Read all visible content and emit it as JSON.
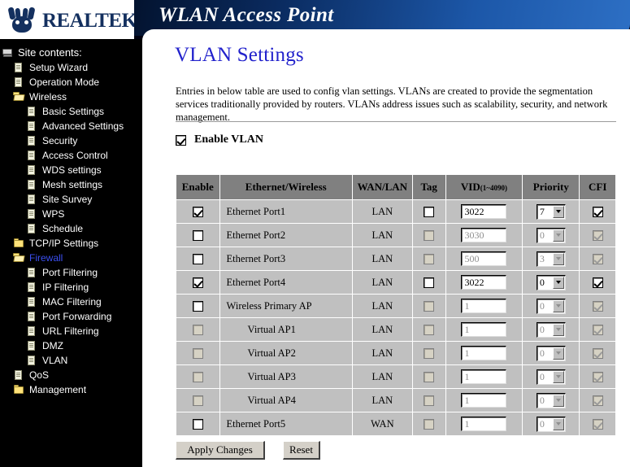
{
  "brand": {
    "logo_text": "REALTEK",
    "banner_title": "WLAN Access Point"
  },
  "sidebar": {
    "root_label": "Site contents:",
    "items": [
      {
        "label": "Setup Wizard",
        "level": 1,
        "icon": "page-icon",
        "active": false
      },
      {
        "label": "Operation Mode",
        "level": 1,
        "icon": "page-icon",
        "active": false
      },
      {
        "label": "Wireless",
        "level": 1,
        "icon": "folder-open-icon",
        "active": false
      },
      {
        "label": "Basic Settings",
        "level": 2,
        "icon": "page-icon",
        "active": false
      },
      {
        "label": "Advanced Settings",
        "level": 2,
        "icon": "page-icon",
        "active": false
      },
      {
        "label": "Security",
        "level": 2,
        "icon": "page-icon",
        "active": false
      },
      {
        "label": "Access Control",
        "level": 2,
        "icon": "page-icon",
        "active": false
      },
      {
        "label": "WDS settings",
        "level": 2,
        "icon": "page-icon",
        "active": false
      },
      {
        "label": "Mesh settings",
        "level": 2,
        "icon": "page-icon",
        "active": false
      },
      {
        "label": "Site Survey",
        "level": 2,
        "icon": "page-icon",
        "active": false
      },
      {
        "label": "WPS",
        "level": 2,
        "icon": "page-icon",
        "active": false
      },
      {
        "label": "Schedule",
        "level": 2,
        "icon": "page-icon",
        "active": false
      },
      {
        "label": "TCP/IP Settings",
        "level": 1,
        "icon": "folder-icon",
        "active": false
      },
      {
        "label": "Firewall",
        "level": 1,
        "icon": "folder-open-icon",
        "active": true
      },
      {
        "label": "Port Filtering",
        "level": 2,
        "icon": "page-icon",
        "active": false
      },
      {
        "label": "IP Filtering",
        "level": 2,
        "icon": "page-icon",
        "active": false
      },
      {
        "label": "MAC Filtering",
        "level": 2,
        "icon": "page-icon",
        "active": false
      },
      {
        "label": "Port Forwarding",
        "level": 2,
        "icon": "page-icon",
        "active": false
      },
      {
        "label": "URL Filtering",
        "level": 2,
        "icon": "page-icon",
        "active": false
      },
      {
        "label": "DMZ",
        "level": 2,
        "icon": "page-icon",
        "active": false
      },
      {
        "label": "VLAN",
        "level": 2,
        "icon": "page-icon",
        "active": false
      },
      {
        "label": "QoS",
        "level": 1,
        "icon": "page-icon",
        "active": false
      },
      {
        "label": "Management",
        "level": 1,
        "icon": "folder-icon",
        "active": false
      }
    ],
    "active_color": "#3b4ff0"
  },
  "main": {
    "title": "VLAN Settings",
    "title_color": "#2222cc",
    "description": "Entries in below table are used to config vlan settings. VLANs are created to provide the segmentation services traditionally provided by routers. VLANs address issues such as scalability, security, and network management.",
    "enable_vlan": {
      "label": "Enable VLAN",
      "checked": true
    },
    "table": {
      "columns": [
        "Enable",
        "Ethernet/Wireless",
        "WAN/LAN",
        "Tag",
        "VID",
        "Priority",
        "CFI"
      ],
      "vid_range_note": "(1~4090)",
      "rows": [
        {
          "interface": "Ethernet Port1",
          "indent": false,
          "enable": true,
          "enable_disabled": false,
          "wan_lan": "LAN",
          "tag": false,
          "tag_disabled": false,
          "vid": "3022",
          "vid_disabled": false,
          "priority": "7",
          "priority_disabled": false,
          "cfi": true,
          "cfi_disabled": false
        },
        {
          "interface": "Ethernet Port2",
          "indent": false,
          "enable": false,
          "enable_disabled": false,
          "wan_lan": "LAN",
          "tag": false,
          "tag_disabled": true,
          "vid": "3030",
          "vid_disabled": true,
          "priority": "0",
          "priority_disabled": true,
          "cfi": true,
          "cfi_disabled": true
        },
        {
          "interface": "Ethernet Port3",
          "indent": false,
          "enable": false,
          "enable_disabled": false,
          "wan_lan": "LAN",
          "tag": false,
          "tag_disabled": true,
          "vid": "500",
          "vid_disabled": true,
          "priority": "3",
          "priority_disabled": true,
          "cfi": true,
          "cfi_disabled": true
        },
        {
          "interface": "Ethernet Port4",
          "indent": false,
          "enable": true,
          "enable_disabled": false,
          "wan_lan": "LAN",
          "tag": false,
          "tag_disabled": false,
          "vid": "3022",
          "vid_disabled": false,
          "priority": "0",
          "priority_disabled": false,
          "cfi": true,
          "cfi_disabled": false
        },
        {
          "interface": "Wireless Primary AP",
          "indent": false,
          "enable": false,
          "enable_disabled": false,
          "wan_lan": "LAN",
          "tag": false,
          "tag_disabled": true,
          "vid": "1",
          "vid_disabled": true,
          "priority": "0",
          "priority_disabled": true,
          "cfi": true,
          "cfi_disabled": true
        },
        {
          "interface": "Virtual AP1",
          "indent": true,
          "enable": false,
          "enable_disabled": true,
          "wan_lan": "LAN",
          "tag": false,
          "tag_disabled": true,
          "vid": "1",
          "vid_disabled": true,
          "priority": "0",
          "priority_disabled": true,
          "cfi": true,
          "cfi_disabled": true
        },
        {
          "interface": "Virtual AP2",
          "indent": true,
          "enable": false,
          "enable_disabled": true,
          "wan_lan": "LAN",
          "tag": false,
          "tag_disabled": true,
          "vid": "1",
          "vid_disabled": true,
          "priority": "0",
          "priority_disabled": true,
          "cfi": true,
          "cfi_disabled": true
        },
        {
          "interface": "Virtual AP3",
          "indent": true,
          "enable": false,
          "enable_disabled": true,
          "wan_lan": "LAN",
          "tag": false,
          "tag_disabled": true,
          "vid": "1",
          "vid_disabled": true,
          "priority": "0",
          "priority_disabled": true,
          "cfi": true,
          "cfi_disabled": true
        },
        {
          "interface": "Virtual AP4",
          "indent": true,
          "enable": false,
          "enable_disabled": true,
          "wan_lan": "LAN",
          "tag": false,
          "tag_disabled": true,
          "vid": "1",
          "vid_disabled": true,
          "priority": "0",
          "priority_disabled": true,
          "cfi": true,
          "cfi_disabled": true
        },
        {
          "interface": "Ethernet Port5",
          "indent": false,
          "enable": false,
          "enable_disabled": false,
          "wan_lan": "WAN",
          "tag": false,
          "tag_disabled": true,
          "vid": "1",
          "vid_disabled": true,
          "priority": "0",
          "priority_disabled": true,
          "cfi": true,
          "cfi_disabled": true
        }
      ]
    },
    "buttons": {
      "apply": "Apply Changes",
      "reset": "Reset"
    }
  }
}
